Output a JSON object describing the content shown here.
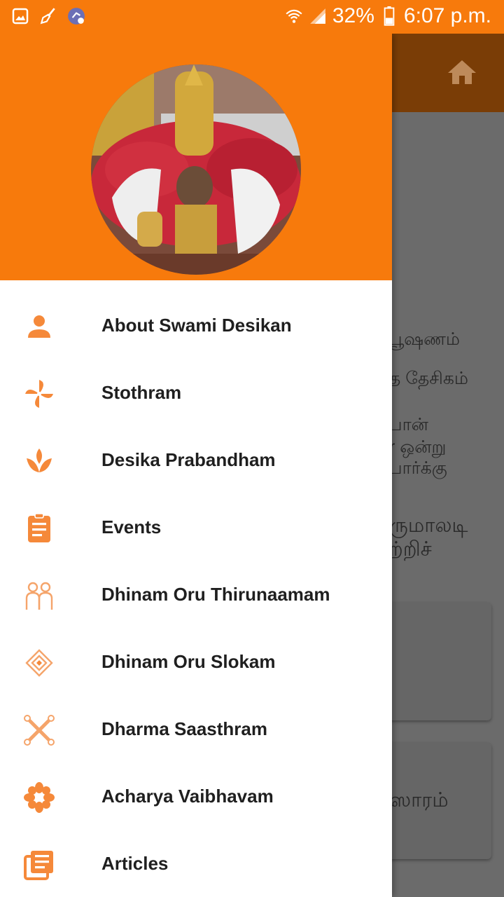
{
  "statusbar": {
    "battery_percent": "32%",
    "time": "6:07 p.m.",
    "icons": [
      "gallery-icon",
      "broom-icon",
      "cleaner-app-icon",
      "wifi-icon",
      "signal-icon",
      "battery-icon"
    ]
  },
  "app_background": {
    "toolbar_icon": "home-icon",
    "text_fragments": [
      "பூஷணம்",
      "த தேசிகம்",
      "பான்",
      "r ஒன்று",
      "பார்க்கு",
      "ருமாலடி",
      "ற்றிச்",
      "ஸாரம்"
    ]
  },
  "drawer": {
    "header_image": "deity-photo",
    "items": [
      {
        "label": "About Swami Desikan",
        "icon": "person-icon"
      },
      {
        "label": "Stothram",
        "icon": "pinwheel-icon"
      },
      {
        "label": "Desika Prabandham",
        "icon": "lotus-icon"
      },
      {
        "label": "Events",
        "icon": "clipboard-icon"
      },
      {
        "label": "Dhinam Oru Thirunaamam",
        "icon": "couple-icon"
      },
      {
        "label": "Dhinam Oru Slokam",
        "icon": "diamond-icon"
      },
      {
        "label": "Dharma Saasthram",
        "icon": "bones-icon"
      },
      {
        "label": "Acharya Vaibhavam",
        "icon": "flower-icon"
      },
      {
        "label": "Articles",
        "icon": "articles-icon"
      }
    ]
  },
  "colors": {
    "accent": "#F77A0C",
    "icon": "#F5893A",
    "toolbar_dim": "#7A3D06",
    "scrim": "#6B6B6B"
  }
}
